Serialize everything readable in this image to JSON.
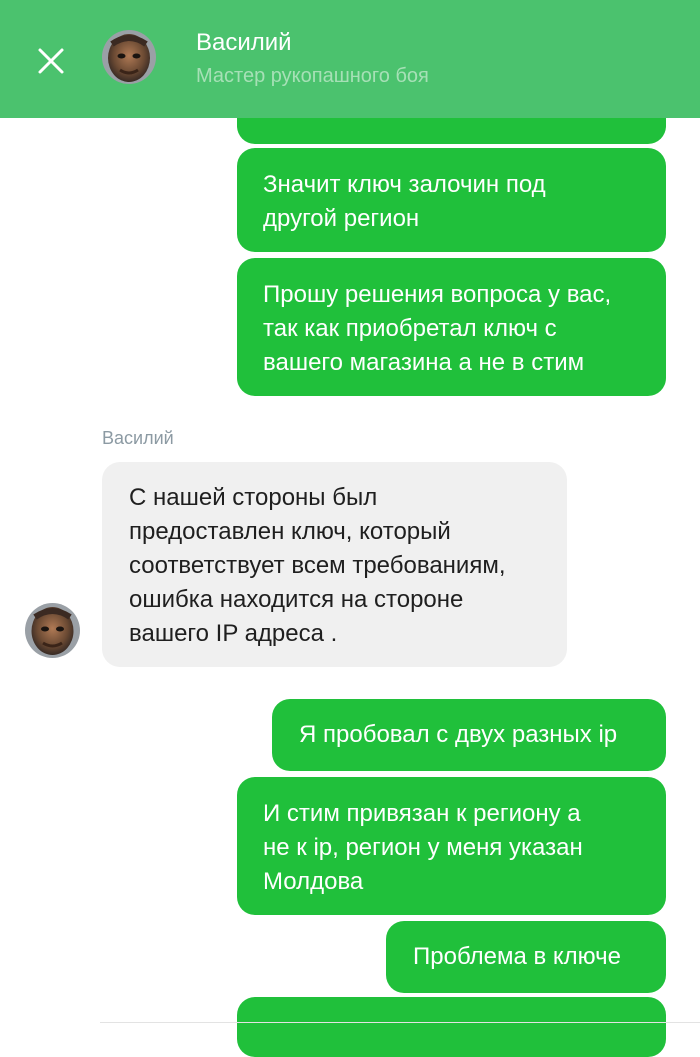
{
  "header": {
    "name": "Василий",
    "subtitle": "Мастер рукопашного боя"
  },
  "chat": {
    "sender_label": "Василий",
    "messages": [
      {
        "direction": "outgoing",
        "text": "Значит ключ залочин под\nдругой регион"
      },
      {
        "direction": "outgoing",
        "text": "Прошу решения вопроса у вас,\nтак как приобретал ключ с\nвашего магазина а не в стим"
      },
      {
        "direction": "incoming",
        "text": "С нашей стороны был\nпредоставлен ключ, который\nсоответствует всем требованиям,\nошибка находится на стороне\nвашего IP адреса ."
      },
      {
        "direction": "outgoing",
        "text": "Я пробовал с двух разных ip"
      },
      {
        "direction": "outgoing",
        "text": "И стим привязан к региону а\nне к ip, регион у меня указан\nМолдова"
      },
      {
        "direction": "outgoing",
        "text": "Проблема в ключе"
      }
    ]
  },
  "colors": {
    "header_bg": "#4bc26e",
    "outgoing_bubble": "#20c03b",
    "incoming_bubble": "#f0f0f0"
  },
  "icons": {
    "close": "close-icon",
    "avatar": "avatar"
  }
}
